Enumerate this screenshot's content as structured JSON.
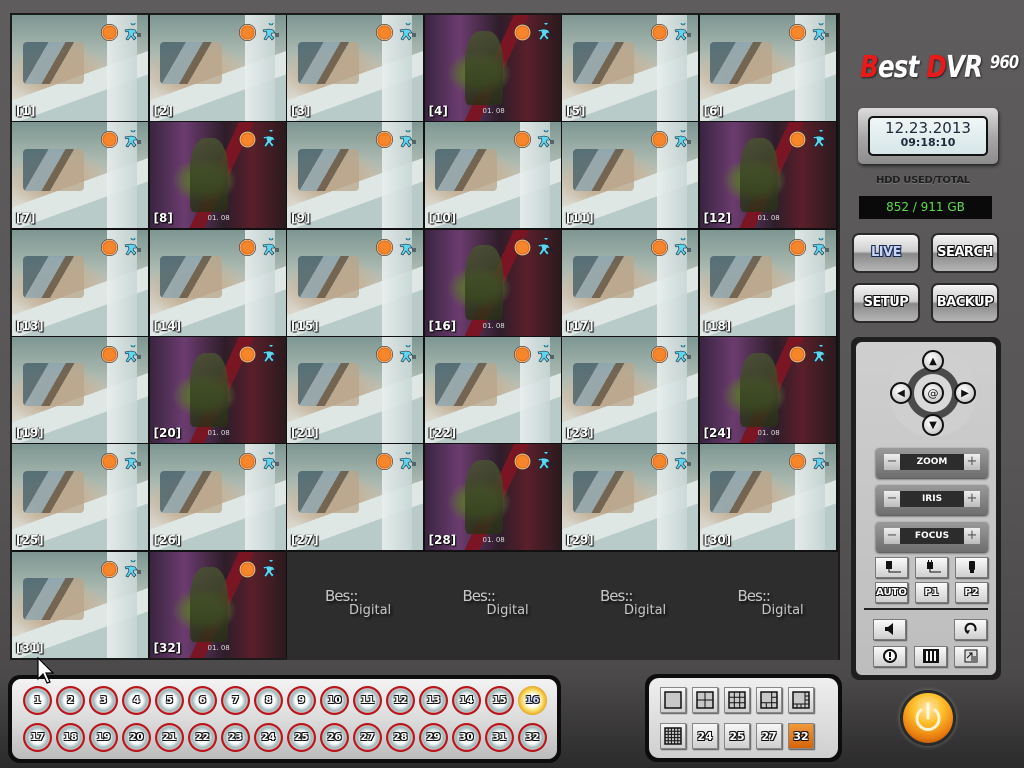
{
  "app": {
    "brand": {
      "letter1": "B",
      "part1": "est ",
      "letter2": "D",
      "part2": "VR ",
      "model": "960"
    },
    "clock": {
      "date": "12.23.2013",
      "time": "09:18:10"
    },
    "hdd": {
      "label": "HDD USED/TOTAL",
      "value": "852 / 911 GB"
    },
    "mode_buttons": [
      {
        "label": "LIVE",
        "active": true
      },
      {
        "label": "SEARCH",
        "active": false
      },
      {
        "label": "SETUP",
        "active": false
      },
      {
        "label": "BACKUP",
        "active": false
      }
    ],
    "ptz": {
      "dpad": {
        "up": "up-arrow",
        "down": "down-arrow",
        "left": "left-arrow",
        "right": "right-arrow",
        "center": "ptz-center"
      },
      "controls": [
        {
          "label": "ZOOM",
          "minus": "−",
          "plus": "+"
        },
        {
          "label": "IRIS",
          "minus": "−",
          "plus": "+"
        },
        {
          "label": "FOCUS",
          "minus": "−",
          "plus": "+"
        }
      ],
      "icon_buttons": [
        "plug-1-icon",
        "plug-2-icon",
        "bulb-icon"
      ],
      "preset_buttons": [
        "AUTO",
        "P1",
        "P2"
      ],
      "bottom_buttons": [
        "speaker-icon",
        "rotate-icon",
        "alarm-icon",
        "sequence-icon",
        "fullscreen-icon"
      ]
    },
    "colors": {
      "accent_active_channel": "#e8a820",
      "layout_active": "#d5630a",
      "hdd_text": "#5ddc4a",
      "logo_red": "#e81a1a"
    }
  },
  "cameras": [
    {
      "label": "[1]",
      "scene": "office"
    },
    {
      "label": "[2]",
      "scene": "office"
    },
    {
      "label": "[3]",
      "scene": "office"
    },
    {
      "label": "[4]",
      "scene": "purple"
    },
    {
      "label": "[5]",
      "scene": "office"
    },
    {
      "label": "[6]",
      "scene": "office"
    },
    {
      "label": "[7]",
      "scene": "office"
    },
    {
      "label": "[8]",
      "scene": "purple"
    },
    {
      "label": "[9]",
      "scene": "office"
    },
    {
      "label": "[10]",
      "scene": "office"
    },
    {
      "label": "[11]",
      "scene": "office"
    },
    {
      "label": "[12]",
      "scene": "purple"
    },
    {
      "label": "[13]",
      "scene": "office"
    },
    {
      "label": "[14]",
      "scene": "office"
    },
    {
      "label": "[15]",
      "scene": "office"
    },
    {
      "label": "[16]",
      "scene": "purple"
    },
    {
      "label": "[17]",
      "scene": "office"
    },
    {
      "label": "[18]",
      "scene": "office"
    },
    {
      "label": "[19]",
      "scene": "office"
    },
    {
      "label": "[20]",
      "scene": "purple"
    },
    {
      "label": "[21]",
      "scene": "office"
    },
    {
      "label": "[22]",
      "scene": "office"
    },
    {
      "label": "[23]",
      "scene": "office"
    },
    {
      "label": "[24]",
      "scene": "purple"
    },
    {
      "label": "[25]",
      "scene": "office"
    },
    {
      "label": "[26]",
      "scene": "office"
    },
    {
      "label": "[27]",
      "scene": "office"
    },
    {
      "label": "[28]",
      "scene": "purple"
    },
    {
      "label": "[29]",
      "scene": "office"
    },
    {
      "label": "[30]",
      "scene": "office"
    },
    {
      "label": "[31]",
      "scene": "office"
    },
    {
      "label": "[32]",
      "scene": "purple"
    }
  ],
  "camera_overlay": {
    "timestamp_text": "01. 08",
    "rec_icon": "record-icon",
    "motion_icon": "motion-icon"
  },
  "empty_slots": [
    {
      "line1": "Bes::",
      "line2": "Digital"
    },
    {
      "line1": "Bes::",
      "line2": "Digital"
    },
    {
      "line1": "Bes::",
      "line2": "Digital"
    },
    {
      "line1": "Bes::",
      "line2": "Digital"
    }
  ],
  "channels": {
    "row1": [
      "1",
      "2",
      "3",
      "4",
      "5",
      "6",
      "7",
      "8",
      "9",
      "10",
      "11",
      "12",
      "13",
      "14",
      "15",
      "16"
    ],
    "row2": [
      "17",
      "18",
      "19",
      "20",
      "21",
      "22",
      "23",
      "24",
      "25",
      "26",
      "27",
      "28",
      "29",
      "30",
      "31",
      "32"
    ],
    "active": "16"
  },
  "layouts": {
    "icons": [
      "layout-1-icon",
      "layout-4-icon",
      "layout-9-icon",
      "layout-6-icon",
      "layout-8-icon",
      "layout-16-icon"
    ],
    "numbered": [
      "24",
      "25",
      "27",
      "32"
    ],
    "active": "32"
  }
}
